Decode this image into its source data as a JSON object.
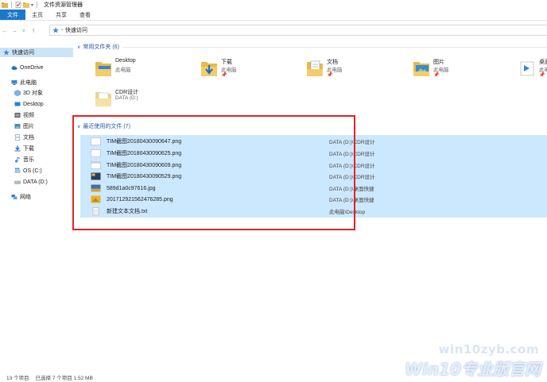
{
  "window": {
    "title": "文件资源管理器"
  },
  "ribbon": {
    "tabs": [
      "文件",
      "主页",
      "共享",
      "查看"
    ]
  },
  "address": {
    "crumb": "快速访问"
  },
  "nav": {
    "items": [
      {
        "label": "快速访问",
        "icon": "star-icon"
      },
      {
        "label": "OneDrive",
        "icon": "cloud-icon"
      },
      {
        "label": "此电脑",
        "icon": "computer-icon"
      },
      {
        "label": "3D 对象",
        "icon": "cube-icon"
      },
      {
        "label": "Desktop",
        "icon": "desktop-folder-icon"
      },
      {
        "label": "视频",
        "icon": "video-folder-icon"
      },
      {
        "label": "图片",
        "icon": "pictures-folder-icon"
      },
      {
        "label": "文档",
        "icon": "documents-folder-icon"
      },
      {
        "label": "下载",
        "icon": "downloads-folder-icon"
      },
      {
        "label": "音乐",
        "icon": "music-folder-icon"
      },
      {
        "label": "OS (C:)",
        "icon": "windows-drive-icon"
      },
      {
        "label": "DATA (D:)",
        "icon": "drive-icon"
      },
      {
        "label": "网络",
        "icon": "network-icon"
      }
    ]
  },
  "frequent": {
    "header": "常用文件夹 (6)",
    "folders": [
      {
        "name": "Desktop",
        "location": "此电脑",
        "pinned": false,
        "icon": "desktop-folder-icon"
      },
      {
        "name": "下载",
        "location": "此电脑",
        "pinned": true,
        "icon": "downloads-folder-icon"
      },
      {
        "name": "文档",
        "location": "此电脑",
        "pinned": true,
        "icon": "documents-folder-icon"
      },
      {
        "name": "图片",
        "location": "此电脑",
        "pinned": true,
        "icon": "pictures-folder-icon"
      },
      {
        "name": "桌面",
        "location": "此电脑",
        "pinned": true,
        "icon": "desktop-folder-icon"
      },
      {
        "name": "CDR设计",
        "location": "DATA (D:)",
        "pinned": false,
        "icon": "folder-icon"
      }
    ],
    "pin_glyph": "📌"
  },
  "recent": {
    "header": "最近使用的文件 (7)",
    "files": [
      {
        "name": "TIM截图20180430090647.png",
        "location": "DATA (D:)\\CDR设计",
        "icon": "white-image-icon"
      },
      {
        "name": "TIM截图20180430090625.png",
        "location": "DATA (D:)\\CDR设计",
        "icon": "white-image-icon"
      },
      {
        "name": "TIM截图20180430090609.png",
        "location": "DATA (D:)\\CDR设计",
        "icon": "white-image-icon"
      },
      {
        "name": "TIM截图20180430090529.png",
        "location": "DATA (D:)\\CDR设计",
        "icon": "dark-image-icon"
      },
      {
        "name": "589d1a0c97616.jpg",
        "location": "DATA (D:)\\桌面快捷",
        "icon": "photo-icon"
      },
      {
        "name": "201712921562476285.png",
        "location": "DATA (D:)\\桌面快捷",
        "icon": "yellow-image-icon"
      },
      {
        "name": "新建文本文档.txt",
        "location": "此电脑\\Desktop",
        "icon": "text-file-icon"
      }
    ]
  },
  "status": {
    "count": "13 个项目",
    "selected": "已选择 7 个项目  1.52 MB"
  },
  "watermark": {
    "url": "win10zyb.com",
    "brand": "Win10专业版官网"
  },
  "colors": {
    "accent": "#1979ca",
    "selection": "#cce8ff",
    "nav_selection": "#cce4f7",
    "highlight_box": "#e02424",
    "group_header": "#1c5aa8"
  }
}
